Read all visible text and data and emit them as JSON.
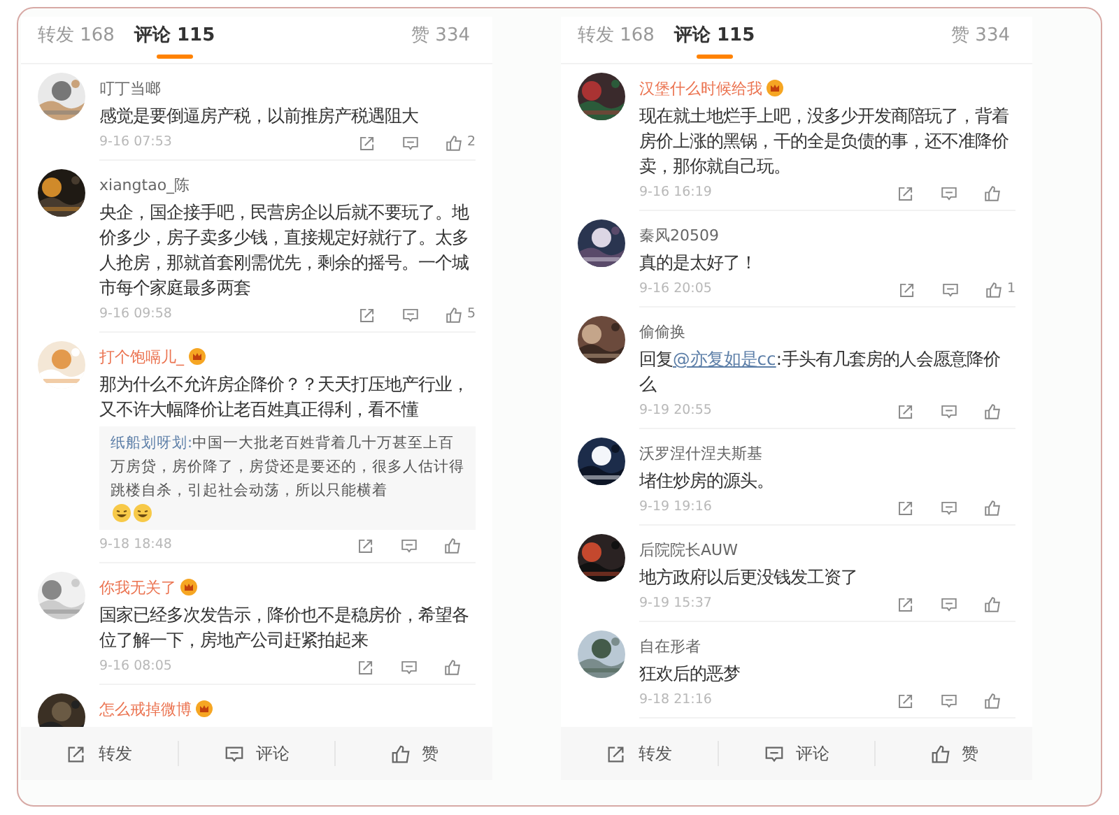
{
  "panels": [
    {
      "tabs": [
        {
          "label": "转发 168",
          "selected": false
        },
        {
          "label": "评论 115",
          "selected": true
        },
        {
          "label": "赞 334",
          "selected": false
        }
      ],
      "comments": [
        {
          "author": "叮丁当啷",
          "vip": false,
          "text": "感觉是要倒逼房产税，以前推房产税遇阻大",
          "time": "9-16 07:53",
          "likes": "2"
        },
        {
          "author": "xiangtao_陈",
          "vip": false,
          "text": "央企，国企接手吧，民营房企以后就不要玩了。地价多少，房子卖多少钱，直接规定好就行了。太多人抢房，那就首套刚需优先，剩余的摇号。一个城市每个家庭最多两套",
          "time": "9-16 09:58",
          "likes": "5"
        },
        {
          "author": "打个饱嗝儿_",
          "vip": true,
          "text": "那为什么不允许房企降价？？天天打压地产行业，又不许大幅降价让老百姓真正得利，看不懂",
          "quote": {
            "author": "纸船划呀划:",
            "text": "中国一大批老百姓背着几十万甚至上百万房贷，房价降了，房贷还是要还的，很多人估计得跳楼自杀，引起社会动荡，所以只能横着",
            "emojis": [
              {
                "kind": "laugh"
              },
              {
                "kind": "laugh"
              }
            ]
          },
          "time": "9-18 18:48"
        },
        {
          "author": "你我无关了",
          "vip": true,
          "text": "国家已经多次发告示，降价也不是稳房价，希望各位了解一下，房地产公司赶紧拍起来",
          "time": "9-16 08:05"
        },
        {
          "author": "怎么戒掉微博",
          "vip": true
        }
      ],
      "actions": [
        {
          "kind": "share",
          "label": "转发"
        },
        {
          "kind": "comment",
          "label": "评论"
        },
        {
          "kind": "like",
          "label": "赞"
        }
      ]
    },
    {
      "tabs": [
        {
          "label": "转发 168",
          "selected": false
        },
        {
          "label": "评论 115",
          "selected": true
        },
        {
          "label": "赞 334",
          "selected": false
        }
      ],
      "comments": [
        {
          "author": "汉堡什么时候给我",
          "vip": true,
          "text": "现在就土地烂手上吧，没多少开发商陪玩了，背着房价上涨的黑锅，干的全是负债的事，还不准降价卖，那你就自己玩。",
          "time": "9-16 16:19"
        },
        {
          "author": "秦风20509",
          "vip": false,
          "text": "真的是太好了！",
          "time": "9-16 20:05",
          "likes": "1"
        },
        {
          "author": "偷偷换",
          "vip": false,
          "text": "回复",
          "mention": "@亦复如是cc",
          "text_after": ":手头有几套房的人会愿意降价么",
          "time": "9-19 20:55"
        },
        {
          "author": "沃罗涅什涅夫斯基",
          "vip": false,
          "text": "堵住炒房的源头。",
          "time": "9-19 19:16"
        },
        {
          "author": "后院院长AUW",
          "vip": false,
          "text": "地方政府以后更没钱发工资了",
          "time": "9-19 15:37"
        },
        {
          "author": "自在形者",
          "vip": false,
          "text": "狂欢后的恶梦",
          "time": "9-18 21:16"
        }
      ],
      "actions": [
        {
          "kind": "share",
          "label": "转发"
        },
        {
          "kind": "comment",
          "label": "评论"
        },
        {
          "kind": "like",
          "label": "赞"
        }
      ]
    }
  ]
}
